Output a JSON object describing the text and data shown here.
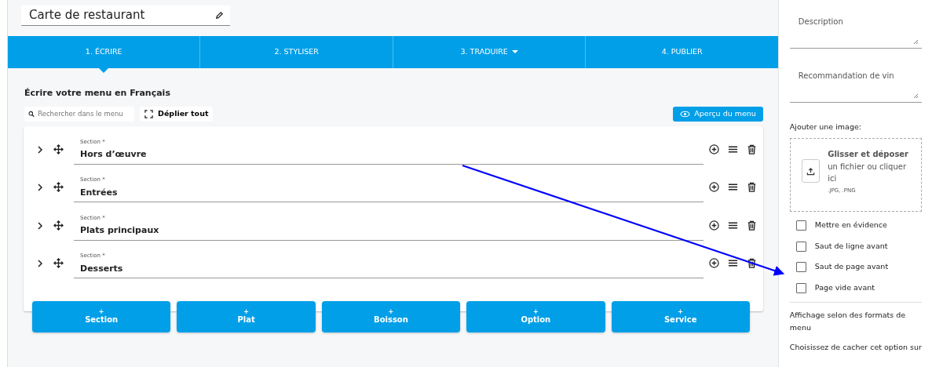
{
  "menu_title": "Carte de restaurant",
  "steps": [
    {
      "label": "1. ÉCRIRE",
      "selected": true,
      "dropdown": false
    },
    {
      "label": "2. STYLISER",
      "selected": false,
      "dropdown": false
    },
    {
      "label": "3. TRADUIRE",
      "selected": false,
      "dropdown": true
    },
    {
      "label": "4. PUBLIER",
      "selected": false,
      "dropdown": false
    }
  ],
  "heading": "Écrire votre menu en Français",
  "search": {
    "placeholder": "Rechercher dans le menu"
  },
  "expand_all": "Déplier tout",
  "preview_button": "Aperçu du menu",
  "sections": [
    {
      "label": "Section *",
      "value": "Hors d’œuvre"
    },
    {
      "label": "Section *",
      "value": "Entrées"
    },
    {
      "label": "Section *",
      "value": "Plats principaux"
    },
    {
      "label": "Section *",
      "value": "Desserts"
    }
  ],
  "add_buttons": [
    {
      "icon": "+",
      "label": "Section"
    },
    {
      "icon": "+",
      "label": "Plat"
    },
    {
      "icon": "+",
      "label": "Boisson"
    },
    {
      "icon": "+",
      "label": "Option"
    },
    {
      "icon": "+",
      "label": "Service"
    }
  ],
  "side_panel": {
    "fields": [
      {
        "placeholder": "Description"
      },
      {
        "placeholder": "Recommandation de vin"
      }
    ],
    "image_label": "Ajouter une image:",
    "dropzone": {
      "title": "Glisser et déposer",
      "text": "un fichier ou cliquer ici",
      "formats": ".JPG, .PNG"
    },
    "options": [
      {
        "label": "Mettre en évidence",
        "checked": false
      },
      {
        "label": "Saut de ligne avant",
        "checked": false
      },
      {
        "label": "Saut de page avant",
        "checked": false
      },
      {
        "label": "Page vide avant",
        "checked": false
      }
    ],
    "display_heading": "Affichage selon des formats de menu",
    "display_text": "Choisissez de cacher cet option sur"
  }
}
